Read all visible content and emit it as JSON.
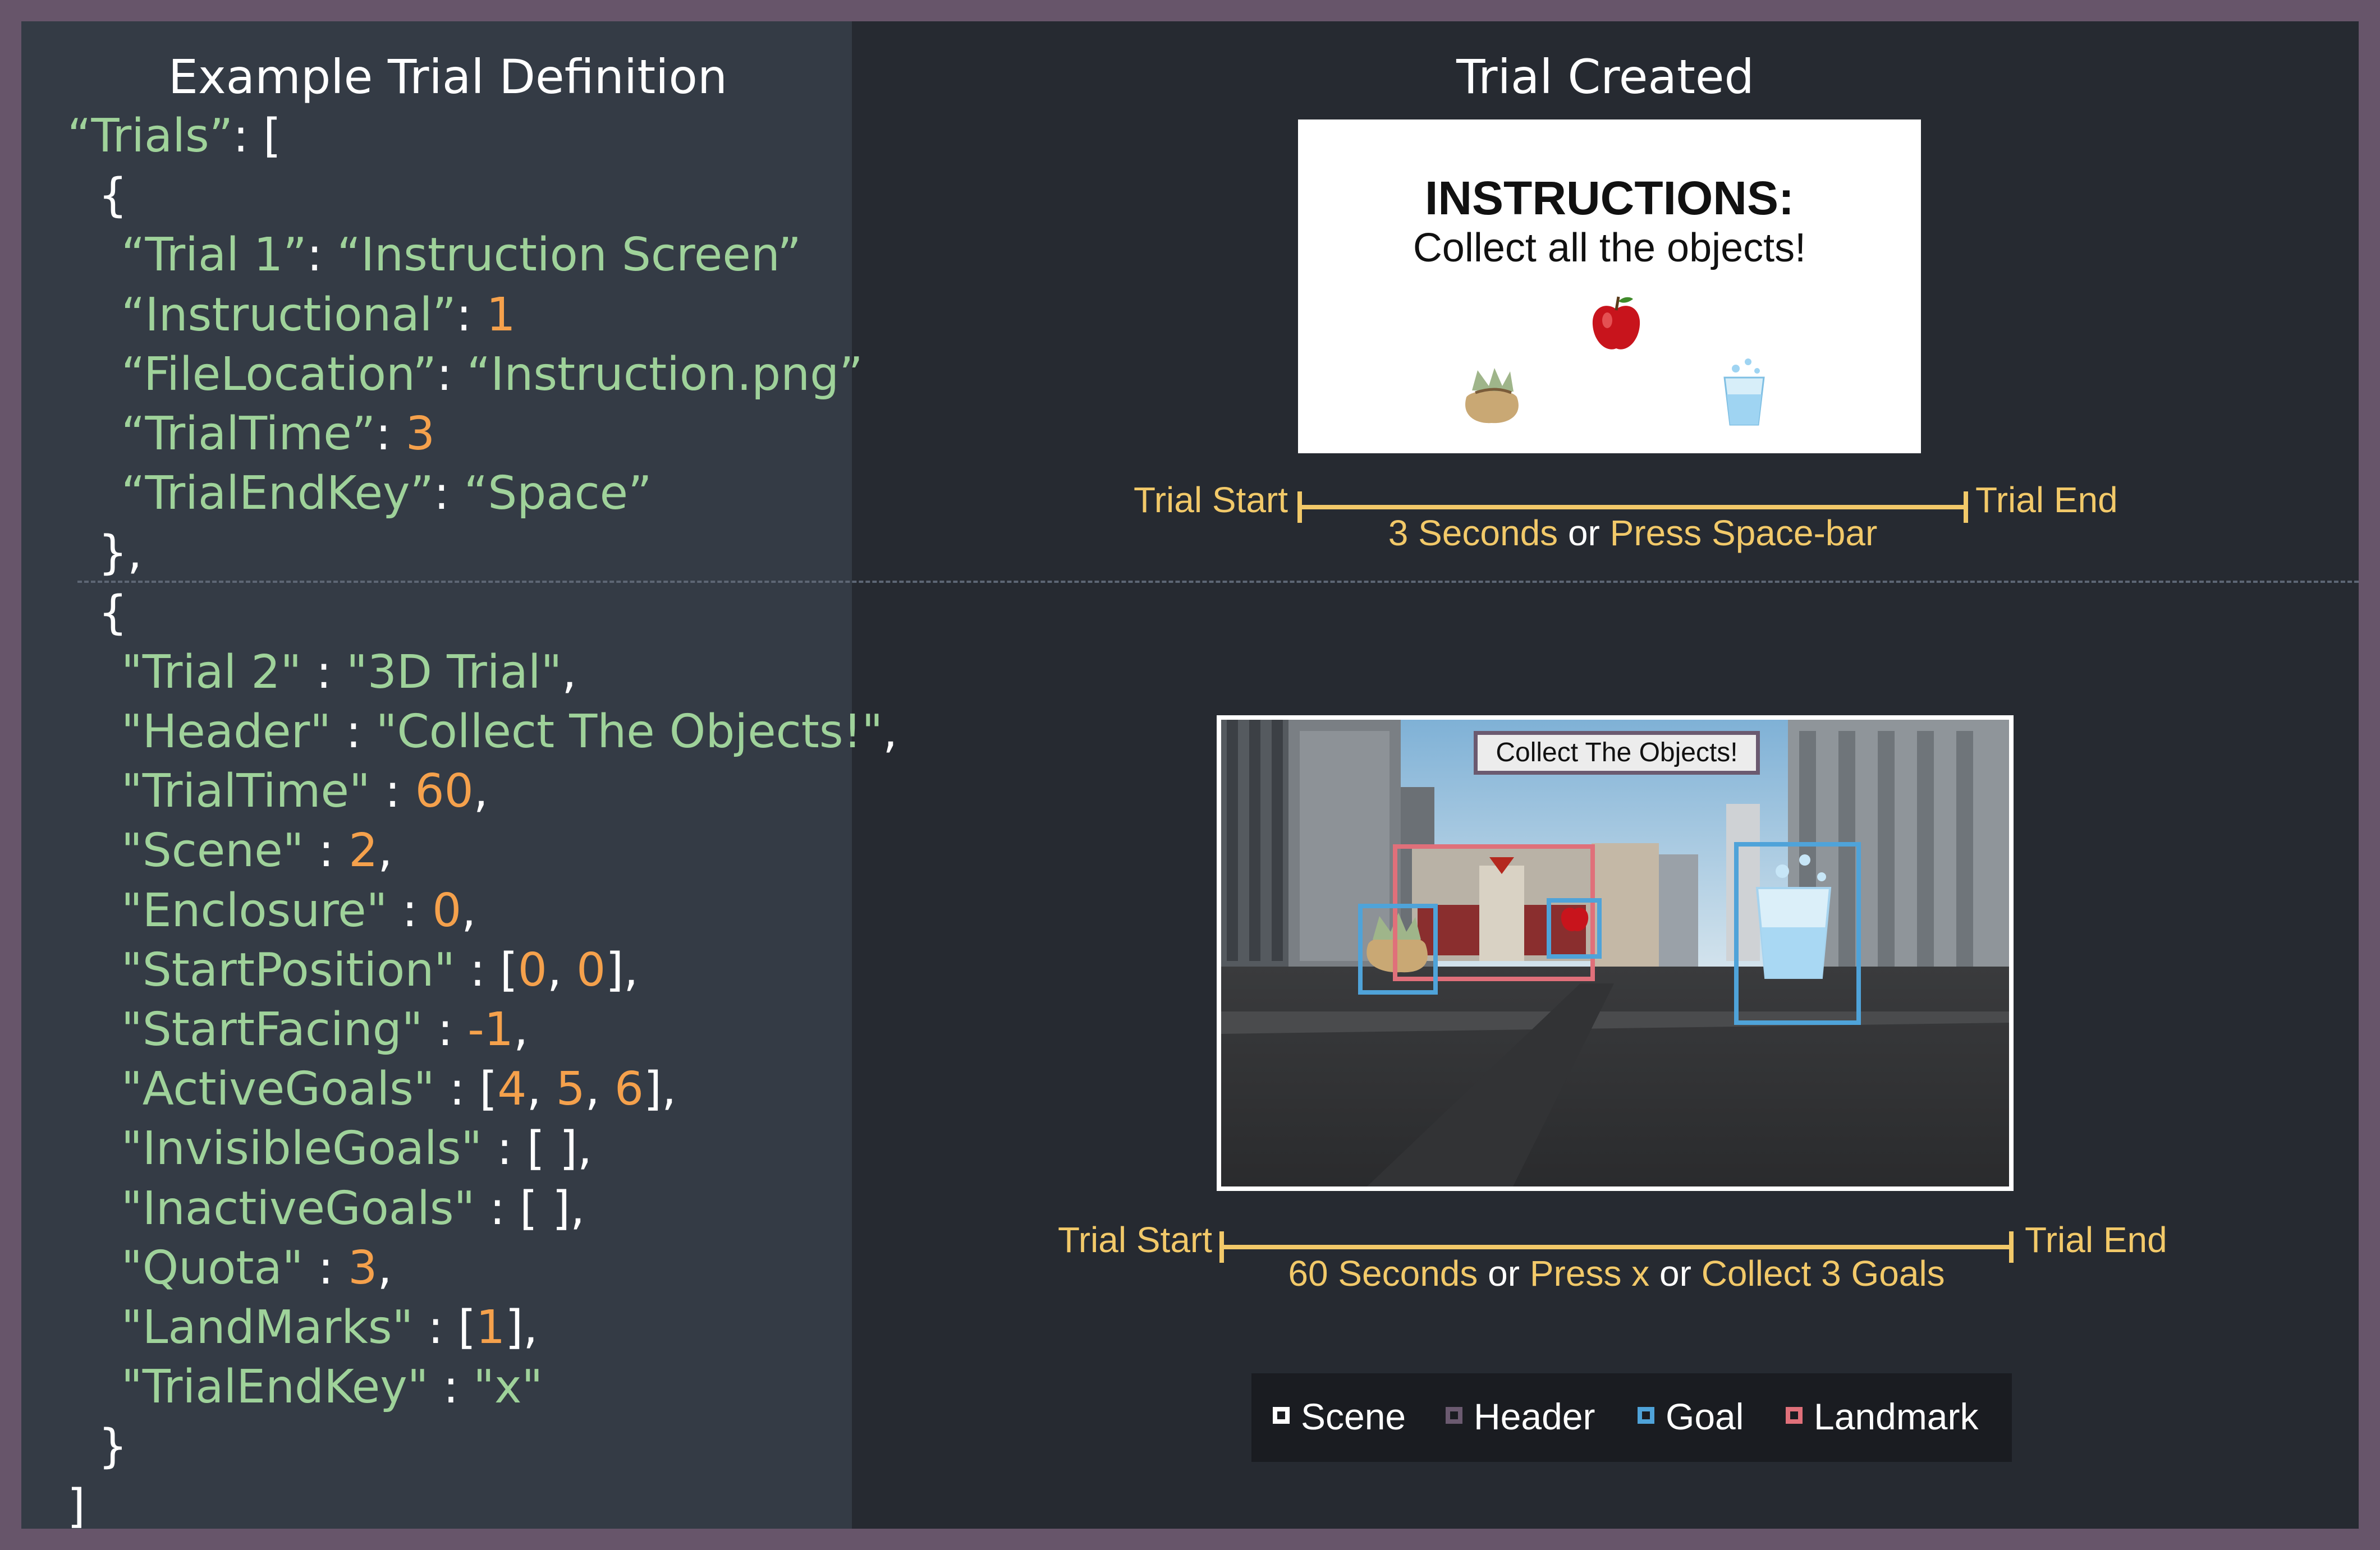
{
  "left_title": "Example Trial Definition",
  "right_title": "Trial Created",
  "code": [
    {
      "indent": 0,
      "tokens": [
        {
          "t": "“Trials”",
          "c": "str"
        },
        {
          "t": ": [",
          "c": "p"
        }
      ]
    },
    {
      "indent": 1,
      "tokens": [
        {
          "t": "{",
          "c": "p"
        }
      ]
    },
    {
      "indent": 2,
      "tokens": [
        {
          "t": "“Trial 1”",
          "c": "str"
        },
        {
          "t": ": ",
          "c": "p"
        },
        {
          "t": "“Instruction Screen”",
          "c": "str"
        }
      ]
    },
    {
      "indent": 2,
      "tokens": [
        {
          "t": "“Instructional”",
          "c": "str"
        },
        {
          "t": ": ",
          "c": "p"
        },
        {
          "t": "1",
          "c": "num"
        }
      ]
    },
    {
      "indent": 2,
      "tokens": [
        {
          "t": "“FileLocation”",
          "c": "str"
        },
        {
          "t": ": ",
          "c": "p"
        },
        {
          "t": "“Instruction.png”",
          "c": "str"
        }
      ]
    },
    {
      "indent": 2,
      "tokens": [
        {
          "t": "“TrialTime”",
          "c": "str"
        },
        {
          "t": ": ",
          "c": "p"
        },
        {
          "t": "3",
          "c": "num"
        }
      ]
    },
    {
      "indent": 2,
      "tokens": [
        {
          "t": "“TrialEndKey”",
          "c": "str"
        },
        {
          "t": ": ",
          "c": "p"
        },
        {
          "t": "“Space”",
          "c": "str"
        }
      ]
    },
    {
      "indent": 1,
      "tokens": [
        {
          "t": "},",
          "c": "p"
        }
      ]
    },
    {
      "indent": 1,
      "tokens": [
        {
          "t": "{",
          "c": "p"
        }
      ]
    },
    {
      "indent": 2,
      "tokens": [
        {
          "t": "\"Trial 2\"",
          "c": "str"
        },
        {
          "t": " : ",
          "c": "p"
        },
        {
          "t": "\"3D Trial\"",
          "c": "str"
        },
        {
          "t": ",",
          "c": "p"
        }
      ]
    },
    {
      "indent": 2,
      "tokens": [
        {
          "t": "\"Header\"",
          "c": "str"
        },
        {
          "t": " : ",
          "c": "p"
        },
        {
          "t": "\"Collect The Objects!\"",
          "c": "str"
        },
        {
          "t": ",",
          "c": "p"
        }
      ]
    },
    {
      "indent": 2,
      "tokens": [
        {
          "t": "\"TrialTime\"",
          "c": "str"
        },
        {
          "t": " : ",
          "c": "p"
        },
        {
          "t": "60",
          "c": "num"
        },
        {
          "t": ",",
          "c": "p"
        }
      ]
    },
    {
      "indent": 2,
      "tokens": [
        {
          "t": "\"Scene\"",
          "c": "str"
        },
        {
          "t": " : ",
          "c": "p"
        },
        {
          "t": "2",
          "c": "num"
        },
        {
          "t": ",",
          "c": "p"
        }
      ]
    },
    {
      "indent": 2,
      "tokens": [
        {
          "t": "\"Enclosure\"",
          "c": "str"
        },
        {
          "t": " : ",
          "c": "p"
        },
        {
          "t": "0",
          "c": "num"
        },
        {
          "t": ",",
          "c": "p"
        }
      ]
    },
    {
      "indent": 2,
      "tokens": [
        {
          "t": "\"StartPosition\"",
          "c": "str"
        },
        {
          "t": " : [",
          "c": "p"
        },
        {
          "t": "0",
          "c": "num"
        },
        {
          "t": ", ",
          "c": "p"
        },
        {
          "t": "0",
          "c": "num"
        },
        {
          "t": "],",
          "c": "p"
        }
      ]
    },
    {
      "indent": 2,
      "tokens": [
        {
          "t": "\"StartFacing\"",
          "c": "str"
        },
        {
          "t": " : ",
          "c": "p"
        },
        {
          "t": "-1",
          "c": "num"
        },
        {
          "t": ",",
          "c": "p"
        }
      ]
    },
    {
      "indent": 2,
      "tokens": [
        {
          "t": "\"ActiveGoals\"",
          "c": "str"
        },
        {
          "t": " : [",
          "c": "p"
        },
        {
          "t": "4",
          "c": "num"
        },
        {
          "t": ", ",
          "c": "p"
        },
        {
          "t": "5",
          "c": "num"
        },
        {
          "t": ", ",
          "c": "p"
        },
        {
          "t": "6",
          "c": "num"
        },
        {
          "t": "],",
          "c": "p"
        }
      ]
    },
    {
      "indent": 2,
      "tokens": [
        {
          "t": "\"InvisibleGoals\"",
          "c": "str"
        },
        {
          "t": " : [ ],",
          "c": "p"
        }
      ]
    },
    {
      "indent": 2,
      "tokens": [
        {
          "t": "\"InactiveGoals\"",
          "c": "str"
        },
        {
          "t": " : [ ],",
          "c": "p"
        }
      ]
    },
    {
      "indent": 2,
      "tokens": [
        {
          "t": "\"Quota\"",
          "c": "str"
        },
        {
          "t": " : ",
          "c": "p"
        },
        {
          "t": "3",
          "c": "num"
        },
        {
          "t": ",",
          "c": "p"
        }
      ]
    },
    {
      "indent": 2,
      "tokens": [
        {
          "t": "\"LandMarks\"",
          "c": "str"
        },
        {
          "t": " : [",
          "c": "p"
        },
        {
          "t": "1",
          "c": "num"
        },
        {
          "t": "],",
          "c": "p"
        }
      ]
    },
    {
      "indent": 2,
      "tokens": [
        {
          "t": "\"TrialEndKey\"",
          "c": "str"
        },
        {
          "t": " : ",
          "c": "p"
        },
        {
          "t": "\"x\"",
          "c": "str"
        }
      ]
    },
    {
      "indent": 1,
      "tokens": [
        {
          "t": "}",
          "c": "p"
        }
      ]
    },
    {
      "indent": 0,
      "tokens": [
        {
          "t": "]",
          "c": "p"
        }
      ]
    }
  ],
  "instruction_screen": {
    "title": "INSTRUCTIONS:",
    "subtitle": "Collect all the objects!",
    "icons": [
      "apple-icon",
      "money-bag-icon",
      "water-glass-icon"
    ]
  },
  "timeline1": {
    "start": "Trial Start",
    "end": "Trial End",
    "condition": [
      {
        "t": "3 Seconds",
        "c": "y"
      },
      {
        "t": " or ",
        "c": "w"
      },
      {
        "t": "Press Space-bar",
        "c": "y"
      }
    ]
  },
  "scene": {
    "header": "Collect The Objects!"
  },
  "timeline2": {
    "start": "Trial Start",
    "end": "Trial End",
    "condition": [
      {
        "t": "60 Seconds",
        "c": "y"
      },
      {
        "t": " or ",
        "c": "w"
      },
      {
        "t": "Press x",
        "c": "y"
      },
      {
        "t": " or ",
        "c": "w"
      },
      {
        "t": "Collect 3 Goals",
        "c": "y"
      }
    ]
  },
  "legend": [
    {
      "label": "Scene",
      "color": "#ffffff"
    },
    {
      "label": "Header",
      "color": "#6b5a70"
    },
    {
      "label": "Goal",
      "color": "#4fa3d9"
    },
    {
      "label": "Landmark",
      "color": "#e0707a"
    }
  ],
  "colors": {
    "string": "#9fd29a",
    "number": "#f5a14c",
    "timeline": "#f2c969",
    "frame": "#67556a"
  }
}
